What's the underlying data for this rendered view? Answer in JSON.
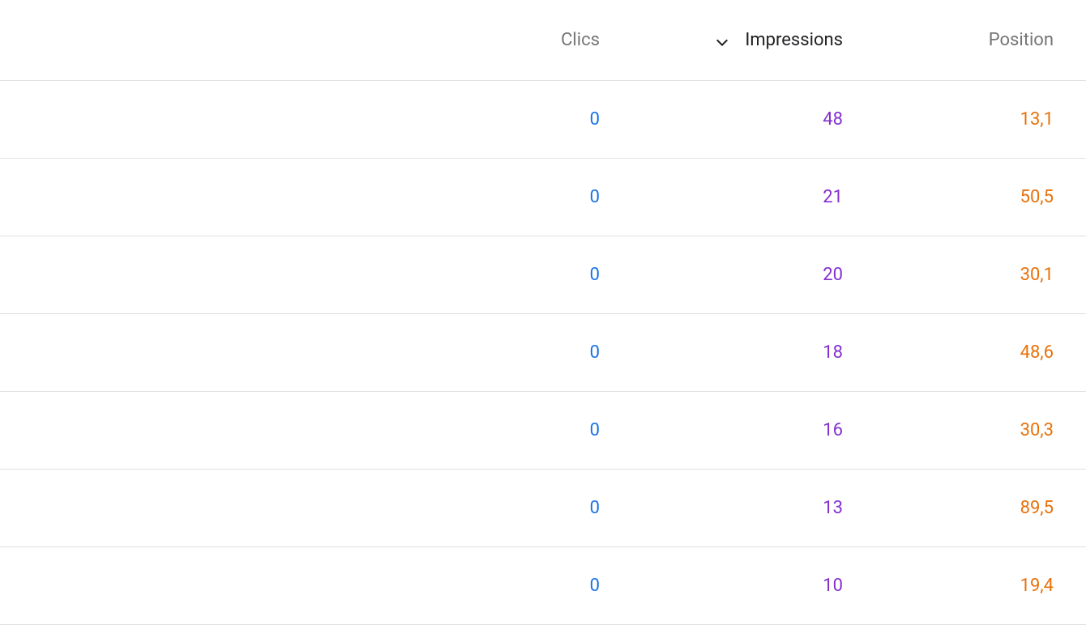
{
  "table": {
    "headers": {
      "clics": "Clics",
      "impressions": "Impressions",
      "position": "Position"
    },
    "sorted_column": "impressions",
    "sort_direction": "desc",
    "rows": [
      {
        "clics": "0",
        "impressions": "48",
        "position": "13,1"
      },
      {
        "clics": "0",
        "impressions": "21",
        "position": "50,5"
      },
      {
        "clics": "0",
        "impressions": "20",
        "position": "30,1"
      },
      {
        "clics": "0",
        "impressions": "18",
        "position": "48,6"
      },
      {
        "clics": "0",
        "impressions": "16",
        "position": "30,3"
      },
      {
        "clics": "0",
        "impressions": "13",
        "position": "89,5"
      },
      {
        "clics": "0",
        "impressions": "10",
        "position": "19,4"
      }
    ]
  }
}
